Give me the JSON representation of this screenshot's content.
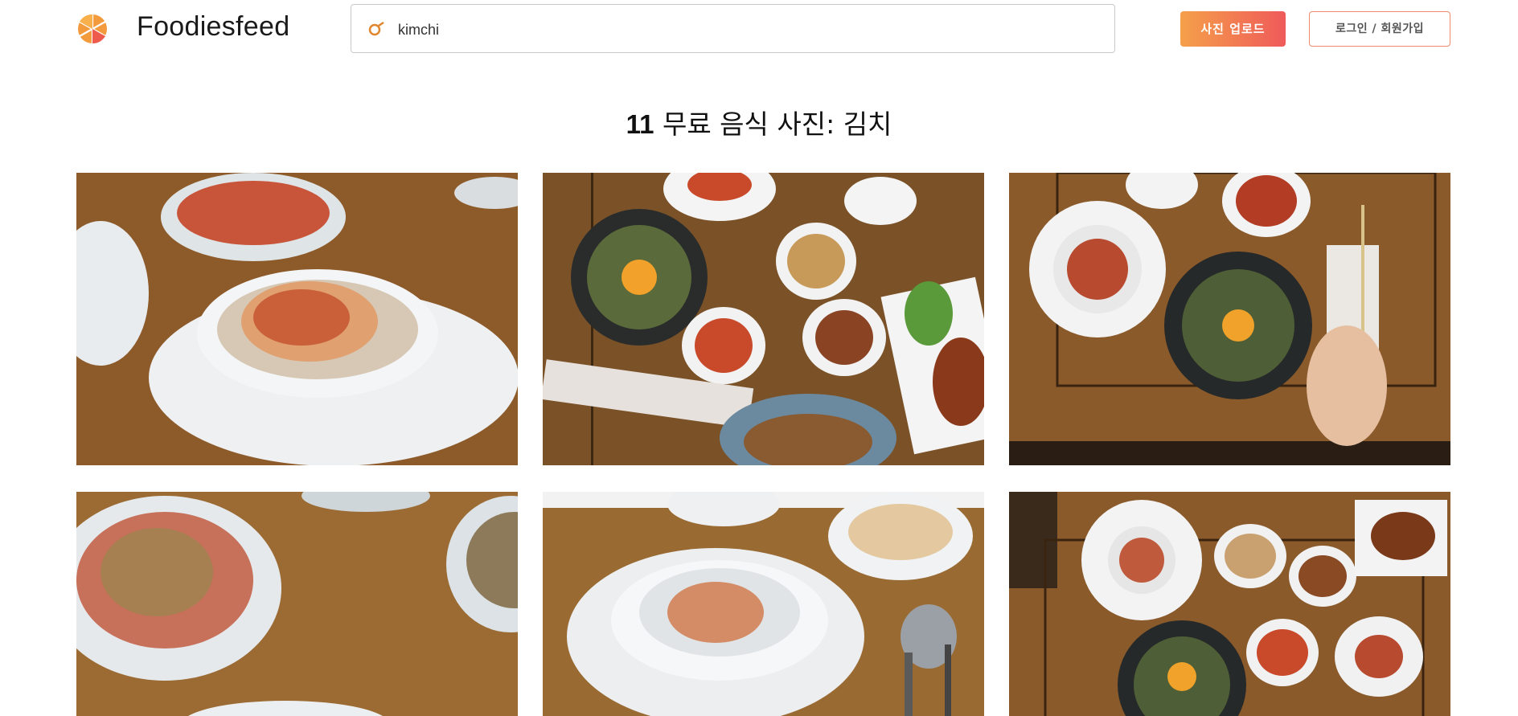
{
  "header": {
    "brand": "Foodiesfeed",
    "search": {
      "value": "kimchi"
    },
    "upload_label": "사진 업로드",
    "login_label": "로그인 / 회원가입"
  },
  "results": {
    "count": "11",
    "heading": "무료 음식 사진: 김치"
  },
  "photos": [
    {
      "subject": "kimchi in white bowl close-up"
    },
    {
      "subject": "bibimbap with side dishes and chopsticks"
    },
    {
      "subject": "bibimbap table top view with spoon"
    },
    {
      "subject": "blurred side dish bowls"
    },
    {
      "subject": "stacked bowls with kimchi"
    },
    {
      "subject": "korean table spread with bibimbap"
    }
  ],
  "colors": {
    "accent_start": "#f5a04a",
    "accent_end": "#ef5a5a",
    "wood": "#8a5a2b"
  }
}
